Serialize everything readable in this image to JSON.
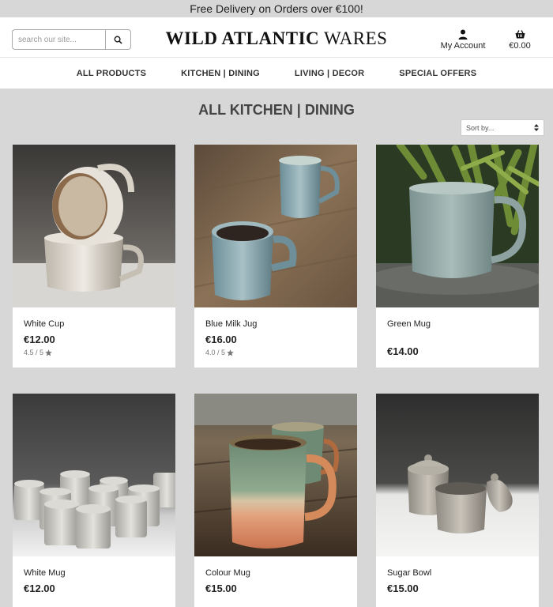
{
  "banner": {
    "text": "Free Delivery on Orders over €100!"
  },
  "header": {
    "search_placeholder": "search our site...",
    "logo": {
      "bold": "WILD ATLANTIC",
      "light": "WARES"
    },
    "account_label": "My Account",
    "cart_total": "€0.00"
  },
  "nav": {
    "items": [
      {
        "label": "ALL PRODUCTS"
      },
      {
        "label": "KITCHEN | DINING"
      },
      {
        "label": "LIVING | DECOR"
      },
      {
        "label": "SPECIAL OFFERS"
      }
    ]
  },
  "page": {
    "title": "ALL KITCHEN | DINING",
    "sort_label": "Sort by..."
  },
  "products": [
    {
      "name": "White Cup",
      "price": "€12.00",
      "rating": "4.5 / 5"
    },
    {
      "name": "Blue Milk Jug",
      "price": "€16.00",
      "rating": "4.0 / 5"
    },
    {
      "name": "Green Mug",
      "price": "€14.00",
      "rating": ""
    },
    {
      "name": "White Mug",
      "price": "€12.00",
      "rating": ""
    },
    {
      "name": "Colour Mug",
      "price": "€15.00",
      "rating": ""
    },
    {
      "name": "Sugar Bowl",
      "price": "€15.00",
      "rating": ""
    }
  ]
}
